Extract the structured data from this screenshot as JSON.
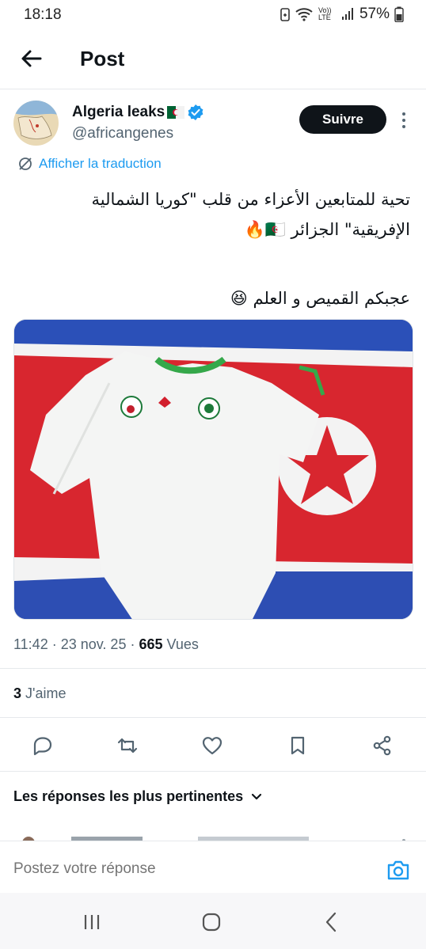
{
  "status_bar": {
    "time": "18:18",
    "network": "Vo)) LTE",
    "battery": "57%"
  },
  "header": {
    "title": "Post"
  },
  "author": {
    "name": "Algeria leaks",
    "handle": "@africangenes",
    "follow_label": "Suivre"
  },
  "translate_label": "Afficher la traduction",
  "tweet": {
    "lines": [
      "تحية للمتابعين الأعزاء من قلب \"كوريا الشمالية",
      "الإفريقية\" الجزائر 🇩🇿🔥",
      "",
      "عجبكم القميص و العلم 😆"
    ]
  },
  "meta": {
    "time": "11:42",
    "date": "23 nov. 25",
    "views_count": "665",
    "views_label": "Vues"
  },
  "likes": {
    "count": "3",
    "label": "J'aime"
  },
  "replies": {
    "header": "Les réponses les plus pertinentes"
  },
  "reply_box": {
    "placeholder": "Postez votre réponse"
  },
  "colors": {
    "accent": "#1d9bf0",
    "text": "#0f1419",
    "muted": "#536471"
  },
  "icons": [
    "arrow-left-icon",
    "verified-badge-icon",
    "more-vertical-icon",
    "translate-icon",
    "reply-icon",
    "retweet-icon",
    "like-icon",
    "bookmark-icon",
    "share-icon",
    "chevron-down-icon",
    "camera-icon"
  ]
}
